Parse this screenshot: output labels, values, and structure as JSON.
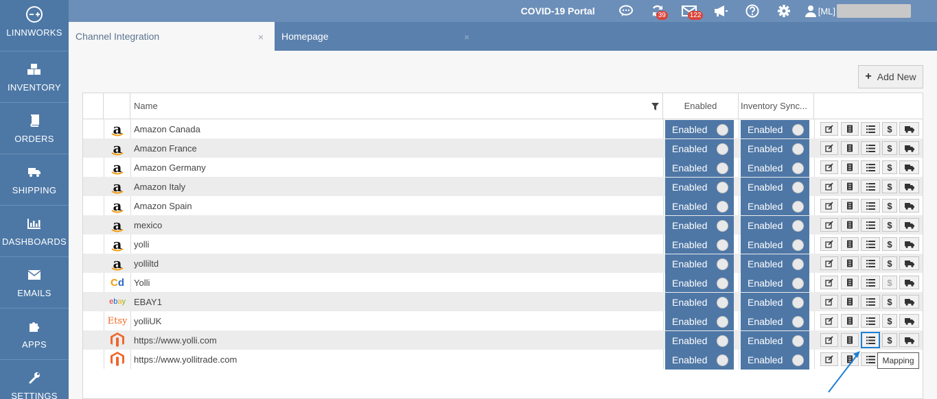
{
  "sidebar": {
    "brand": "LINNWORKS",
    "items": [
      {
        "label": "INVENTORY",
        "icon": "boxes-icon"
      },
      {
        "label": "ORDERS",
        "icon": "book-icon"
      },
      {
        "label": "SHIPPING",
        "icon": "truck-icon"
      },
      {
        "label": "DASHBOARDS",
        "icon": "bar-chart-icon"
      },
      {
        "label": "EMAILS",
        "icon": "envelope-icon"
      },
      {
        "label": "APPS",
        "icon": "puzzle-icon"
      },
      {
        "label": "SETTINGS",
        "icon": "wrench-icon"
      }
    ]
  },
  "topbar": {
    "portal": "COVID-19 Portal",
    "sync_badge": "39",
    "mail_badge": "122",
    "user_prefix": "[ML]"
  },
  "tabs": [
    {
      "label": "Channel Integration",
      "close": "×"
    },
    {
      "label": "Homepage",
      "close": "×"
    }
  ],
  "toolbar": {
    "add_new_label": "Add New",
    "add_new_icon": "+"
  },
  "grid": {
    "headers": {
      "name": "Name",
      "enabled": "Enabled",
      "inventory_sync": "Inventory Sync..."
    },
    "rows": [
      {
        "logo": "a",
        "logo_kind": "amazon",
        "name": "Amazon Canada",
        "enabled": "Enabled",
        "sync": "Enabled"
      },
      {
        "logo": "a",
        "logo_kind": "amazon",
        "name": "Amazon France",
        "enabled": "Enabled",
        "sync": "Enabled"
      },
      {
        "logo": "a",
        "logo_kind": "amazon",
        "name": "Amazon Germany",
        "enabled": "Enabled",
        "sync": "Enabled"
      },
      {
        "logo": "a",
        "logo_kind": "amazon",
        "name": "Amazon Italy",
        "enabled": "Enabled",
        "sync": "Enabled"
      },
      {
        "logo": "a",
        "logo_kind": "amazon",
        "name": "Amazon Spain",
        "enabled": "Enabled",
        "sync": "Enabled"
      },
      {
        "logo": "a",
        "logo_kind": "amazon",
        "name": "mexico",
        "enabled": "Enabled",
        "sync": "Enabled"
      },
      {
        "logo": "a",
        "logo_kind": "amazon",
        "name": "yolli",
        "enabled": "Enabled",
        "sync": "Enabled"
      },
      {
        "logo": "a",
        "logo_kind": "amazon",
        "name": "yolliltd",
        "enabled": "Enabled",
        "sync": "Enabled"
      },
      {
        "logo": "Cd",
        "logo_kind": "cdiscount",
        "name": "Yolli",
        "enabled": "Enabled",
        "sync": "Enabled"
      },
      {
        "logo": "ebay",
        "logo_kind": "ebay",
        "name": "EBAY1",
        "enabled": "Enabled",
        "sync": "Enabled"
      },
      {
        "logo": "Etsy",
        "logo_kind": "etsy",
        "name": "yolliUK",
        "enabled": "Enabled",
        "sync": "Enabled"
      },
      {
        "logo": "",
        "logo_kind": "magento",
        "name": "https://www.yolli.com",
        "enabled": "Enabled",
        "sync": "Enabled"
      },
      {
        "logo": "",
        "logo_kind": "magento",
        "name": "https://www.yollitrade.com",
        "enabled": "Enabled",
        "sync": "Enabled"
      }
    ],
    "actions": [
      {
        "name": "edit-icon"
      },
      {
        "name": "listing-icon"
      },
      {
        "name": "mapping-icon"
      },
      {
        "name": "pricing-icon",
        "glyph": "$"
      },
      {
        "name": "shipping-icon"
      }
    ]
  },
  "tooltip": {
    "text": "Mapping"
  },
  "colors": {
    "sidebar": "#4d78a6",
    "topbar": "#6c8fb9",
    "toggle": "#4e77a6",
    "highlight": "#1c7fd6",
    "amazon_smile": "#f39c12",
    "cd_c": "#f39c12",
    "cd_d": "#2a6bc1",
    "etsy": "#f1641e",
    "magento": "#ee672f"
  }
}
